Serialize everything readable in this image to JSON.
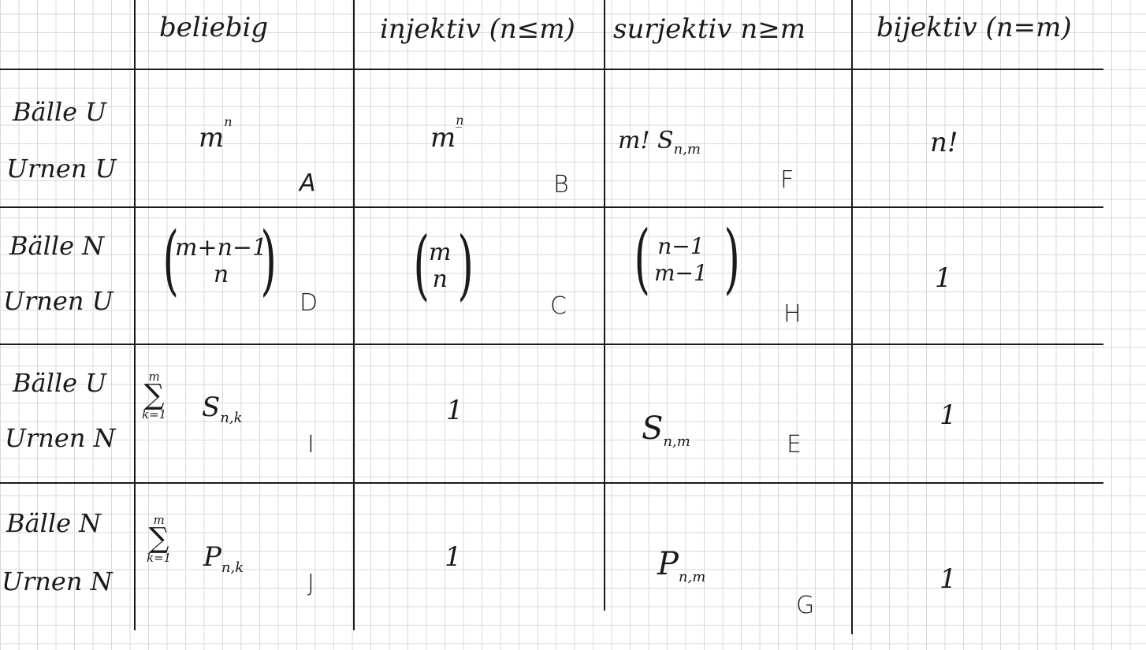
{
  "headers": {
    "any": "beliebig",
    "injective": "injektiv (n≤m)",
    "surjective": "surjektiv n≥m",
    "bijective": "bijektiv (n=m)"
  },
  "rows": [
    {
      "balls": "Bälle U",
      "urns": "Urnen U"
    },
    {
      "balls": "Bälle N",
      "urns": "Urnen U"
    },
    {
      "balls": "Bälle U",
      "urns": "Urnen N"
    },
    {
      "balls": "Bälle N",
      "urns": "Urnen N"
    }
  ],
  "cells": {
    "r1c1": {
      "base": "m",
      "exp": "n",
      "letter": "A"
    },
    "r1c2": {
      "base": "m",
      "exp": "n̲",
      "letter": "B"
    },
    "r1c3": {
      "prefix": "m! S",
      "sub": "n,m",
      "letter": "F"
    },
    "r1c4": {
      "text": "n!"
    },
    "r2c1": {
      "top": "m+n−1",
      "bottom": "n",
      "letter": "D"
    },
    "r2c2": {
      "top": "m",
      "bottom": "n",
      "letter": "C"
    },
    "r2c3": {
      "top": "n−1",
      "bottom": "m−1",
      "letter": "H"
    },
    "r2c4": {
      "text": "1"
    },
    "r3c1": {
      "sum_top": "m",
      "sum_bot": "k=1",
      "term": "S",
      "sub": "n,k",
      "letter": "I"
    },
    "r3c2": {
      "text": "1"
    },
    "r3c3": {
      "term": "S",
      "sub": "n,m",
      "letter": "E"
    },
    "r3c4": {
      "text": "1"
    },
    "r4c1": {
      "sum_top": "m",
      "sum_bot": "k=1",
      "term": "P",
      "sub": "n,k",
      "letter": "J"
    },
    "r4c2": {
      "text": "1"
    },
    "r4c3": {
      "term": "P",
      "sub": "n,m",
      "letter": "G"
    },
    "r4c4": {
      "text": "1"
    }
  }
}
